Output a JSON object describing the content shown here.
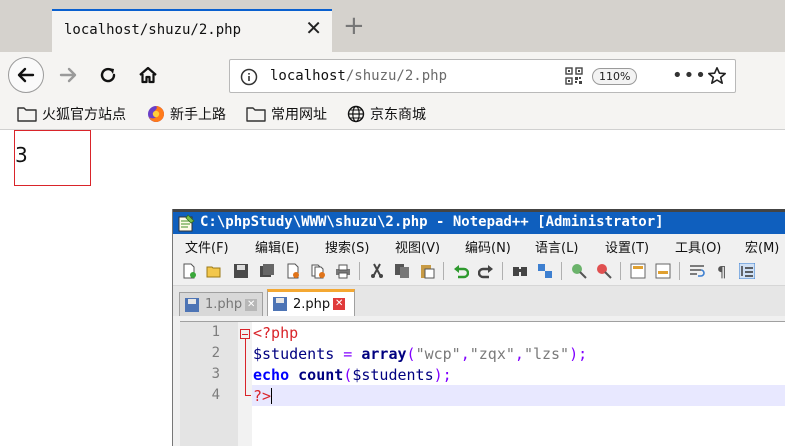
{
  "browser": {
    "tab_title": "localhost/shuzu/2.php",
    "url_host": "localhost",
    "url_path": "/shuzu/2.php",
    "zoom": "110%",
    "bookmarks": [
      "火狐官方站点",
      "新手上路",
      "常用网址",
      "京东商城"
    ]
  },
  "page": {
    "output": "3"
  },
  "notepad": {
    "title": "C:\\phpStudy\\WWW\\shuzu\\2.php - Notepad++ [Administrator]",
    "menu": [
      "文件(F)",
      "编辑(E)",
      "搜索(S)",
      "视图(V)",
      "编码(N)",
      "语言(L)",
      "设置(T)",
      "工具(O)",
      "宏(M)"
    ],
    "file_tabs": [
      "1.php",
      "2.php"
    ],
    "line_numbers": [
      "1",
      "2",
      "3",
      "4"
    ],
    "code": {
      "l1_open": "<?php",
      "l2_var": "$students",
      "l2_eq": " = ",
      "l2_fn": "array",
      "l2_paren_open": "(",
      "l2_s1": "\"wcp\"",
      "l2_comma1": ",",
      "l2_s2": "\"zqx\"",
      "l2_comma2": ",",
      "l2_s3": "\"lzs\"",
      "l2_close": ");",
      "l3_kw": "echo",
      "l3_fn": "count",
      "l3_paren_open": "(",
      "l3_var": "$students",
      "l3_close": ");",
      "l4_close": "?>"
    }
  },
  "colors": {
    "accent_blue": "#0a60cf",
    "npp_title_bg": "#0f5fbe",
    "php_tag": "#d9242a",
    "keyword": "#0000ff",
    "string": "#7a7a7a",
    "operator": "#8000ff"
  }
}
